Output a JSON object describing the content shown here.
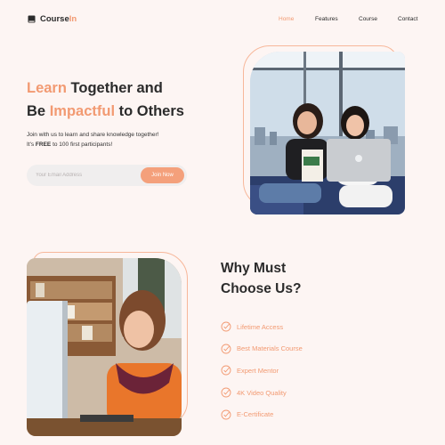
{
  "brand": {
    "name_main": "Course",
    "name_accent": "In"
  },
  "nav": {
    "items": [
      {
        "label": "Home",
        "active": true
      },
      {
        "label": "Features",
        "active": false
      },
      {
        "label": "Course",
        "active": false
      },
      {
        "label": "Contact",
        "active": false
      }
    ]
  },
  "hero": {
    "title_line1_accent": "Learn",
    "title_line1_rest": " Together and",
    "title_line2_start": "Be ",
    "title_line2_accent": "Impactful",
    "title_line2_end": " to Others",
    "desc_line1": "Join with us to learn and share knowledge together!",
    "desc_line2_start": "It's ",
    "desc_line2_bold": "FREE",
    "desc_line2_end": " to 100 first participants!",
    "email_placeholder": "Your Email Address",
    "join_label": "Join Now"
  },
  "why": {
    "title_line1": "Why Must",
    "title_line2": "Choose Us?",
    "items": [
      "Lifetime Access",
      "Best Materials Course",
      "Expert Mentor",
      "4K Video Quality",
      "E-Certificate"
    ]
  },
  "colors": {
    "accent": "#f29a72",
    "background": "#fdf5f3",
    "text": "#2b2b2b"
  },
  "icons": {
    "logo": "book-icon",
    "check": "check-circle-icon"
  }
}
